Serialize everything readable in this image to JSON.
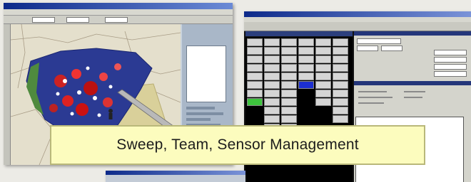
{
  "caption": {
    "text": "Sweep, Team, Sensor Management"
  },
  "colors": {
    "caption_background": "#fcfcbe",
    "caption_border": "#b9b87a",
    "page_background": "#ecebe6",
    "titlebar_blue": "#0d2a8a",
    "selected_cell_blue": "#1d2fd1",
    "selected_cell_green": "#3ec43e"
  },
  "icons": {
    "map_pointer": "pointer-icon",
    "map_person": "person-icon"
  }
}
